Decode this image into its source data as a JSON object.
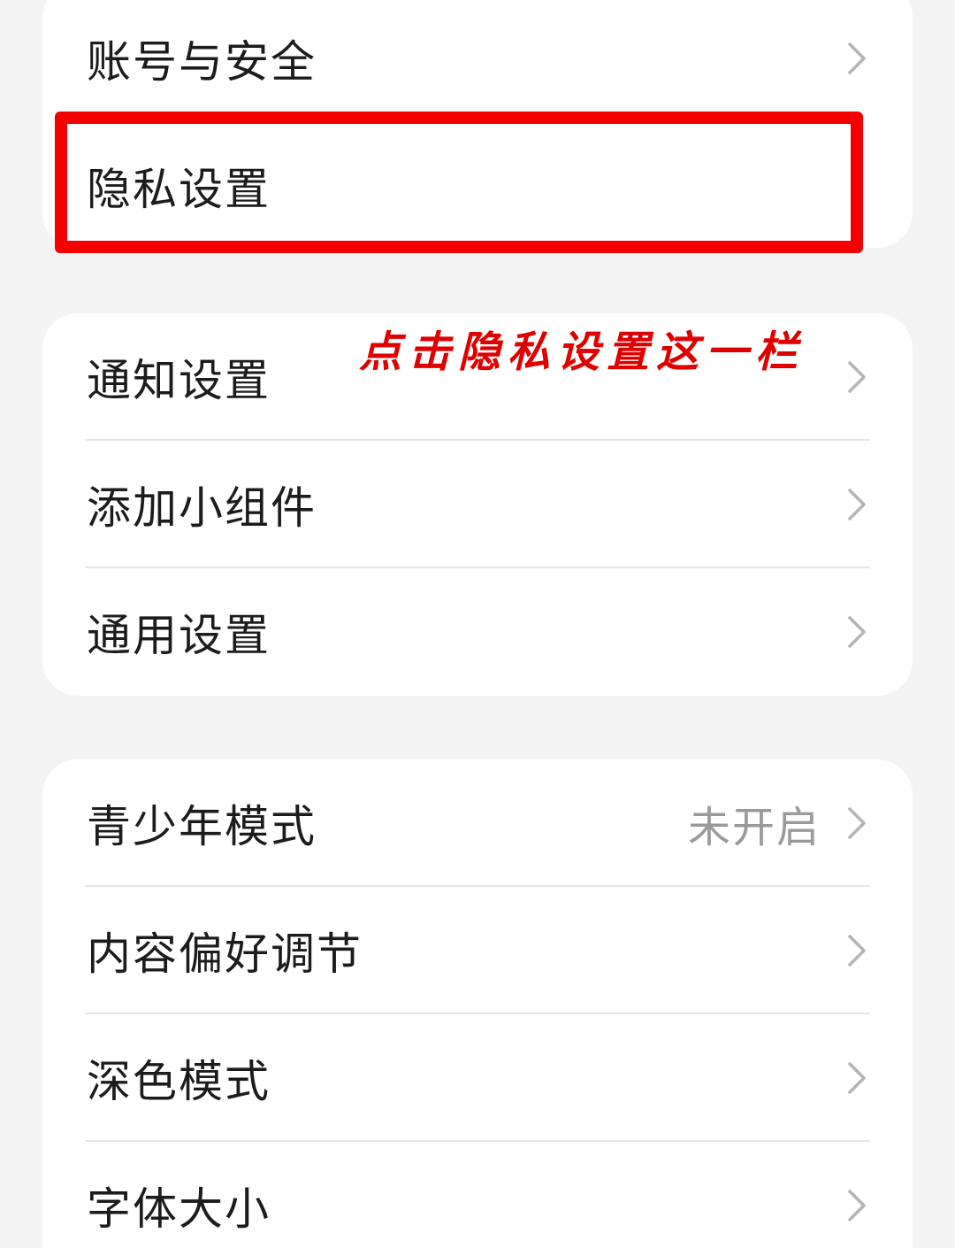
{
  "groups": [
    {
      "items": [
        {
          "label": "账号与安全",
          "value": ""
        },
        {
          "label": "隐私设置",
          "value": ""
        }
      ]
    },
    {
      "items": [
        {
          "label": "通知设置",
          "value": ""
        },
        {
          "label": "添加小组件",
          "value": ""
        },
        {
          "label": "通用设置",
          "value": ""
        }
      ]
    },
    {
      "items": [
        {
          "label": "青少年模式",
          "value": "未开启"
        },
        {
          "label": "内容偏好调节",
          "value": ""
        },
        {
          "label": "深色模式",
          "value": ""
        },
        {
          "label": "字体大小",
          "value": ""
        }
      ]
    }
  ],
  "annotation": {
    "text": "点击隐私设置这一栏",
    "color": "#e00000"
  },
  "highlight": {
    "target": "隐私设置",
    "color": "#f40000"
  },
  "icons": {
    "row_trailing": "chevron-right-icon"
  }
}
